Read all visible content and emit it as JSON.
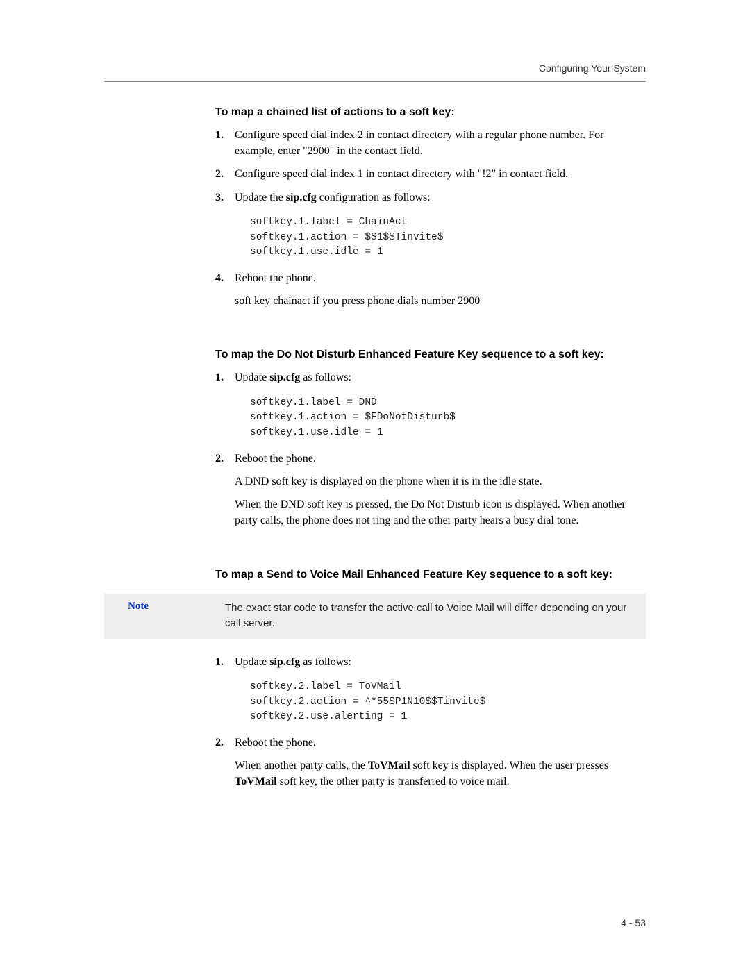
{
  "header": {
    "running_title": "Configuring Your System"
  },
  "section1": {
    "heading": "To map a chained list of actions to a soft key:",
    "step1_num": "1.",
    "step1_text_a": "Configure speed dial index 2 in contact directory with a regular phone number. For example, enter \"2900\" in the contact field.",
    "step2_num": "2.",
    "step2_text": "Configure speed dial index 1 in contact directory with \"!2\" in contact field.",
    "step3_num": "3.",
    "step3_prefix": "Update the ",
    "step3_bold": "sip.cfg",
    "step3_suffix": " configuration as follows:",
    "code1": "softkey.1.label = ChainAct\nsoftkey.1.action = $S1$$Tinvite$\nsoftkey.1.use.idle = 1",
    "step4_num": "4.",
    "step4_text": "Reboot the phone.",
    "step4_sub": "soft key chainact if you press phone dials number 2900"
  },
  "section2": {
    "heading": "To map the Do Not Disturb Enhanced Feature Key sequence to a soft key:",
    "step1_num": "1.",
    "step1_prefix": "Update ",
    "step1_bold": "sip.cfg",
    "step1_suffix": " as follows:",
    "code1": "softkey.1.label = DND\nsoftkey.1.action = $FDoNotDisturb$\nsoftkey.1.use.idle = 1",
    "step2_num": "2.",
    "step2_text": "Reboot the phone.",
    "step2_sub1": "A DND soft key is displayed on the phone when it is in the idle state.",
    "step2_sub2": "When the DND soft key is pressed, the Do Not Disturb icon is displayed. When another party calls, the phone does not ring and the other party hears a busy dial tone."
  },
  "section3": {
    "heading": "To map a Send to Voice Mail Enhanced Feature Key sequence to a soft key:",
    "note_label": "Note",
    "note_text": "The exact star code to transfer the active call to Voice Mail will differ depending on your call server.",
    "step1_num": "1.",
    "step1_prefix": "Update ",
    "step1_bold": "sip.cfg",
    "step1_suffix": " as follows:",
    "code1": "softkey.2.label = ToVMail\nsoftkey.2.action = ^*55$P1N10$$Tinvite$\nsoftkey.2.use.alerting = 1",
    "step2_num": "2.",
    "step2_text": "Reboot the phone.",
    "step2_sub_a": "When another party calls, the ",
    "step2_sub_b": "ToVMail",
    "step2_sub_c": " soft key is displayed. When the user presses ",
    "step2_sub_d": "ToVMail",
    "step2_sub_e": " soft key, the other party is transferred to voice mail."
  },
  "footer": {
    "page_number": "4 - 53"
  }
}
